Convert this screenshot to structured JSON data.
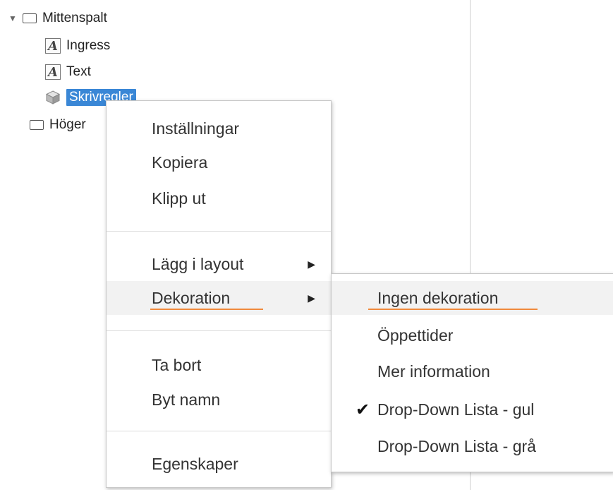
{
  "tree": {
    "expander": "▼",
    "items": [
      {
        "label": "Mittenspalt"
      },
      {
        "label": "Ingress"
      },
      {
        "label": "Text"
      },
      {
        "label": "Skrivregler"
      },
      {
        "label": "Höger"
      }
    ],
    "text_icon_letter": "A"
  },
  "context_menu": {
    "items": [
      {
        "label": "Inställningar"
      },
      {
        "label": "Kopiera"
      },
      {
        "label": "Klipp ut"
      },
      {
        "label": "Lägg i layout"
      },
      {
        "label": "Dekoration"
      },
      {
        "label": "Ta bort"
      },
      {
        "label": "Byt namn"
      },
      {
        "label": "Egenskaper"
      }
    ],
    "submenu_arrow": "▶"
  },
  "submenu": {
    "items": [
      {
        "label": "Ingen dekoration"
      },
      {
        "label": "Öppettider"
      },
      {
        "label": "Mer information"
      },
      {
        "label": "Drop-Down Lista - gul",
        "checked": true
      },
      {
        "label": "Drop-Down Lista - grå"
      }
    ],
    "check_mark": "✔"
  },
  "colors": {
    "selection": "#3a87d6",
    "underline_accent": "#f08a3c",
    "hover": "#f2f2f2"
  }
}
